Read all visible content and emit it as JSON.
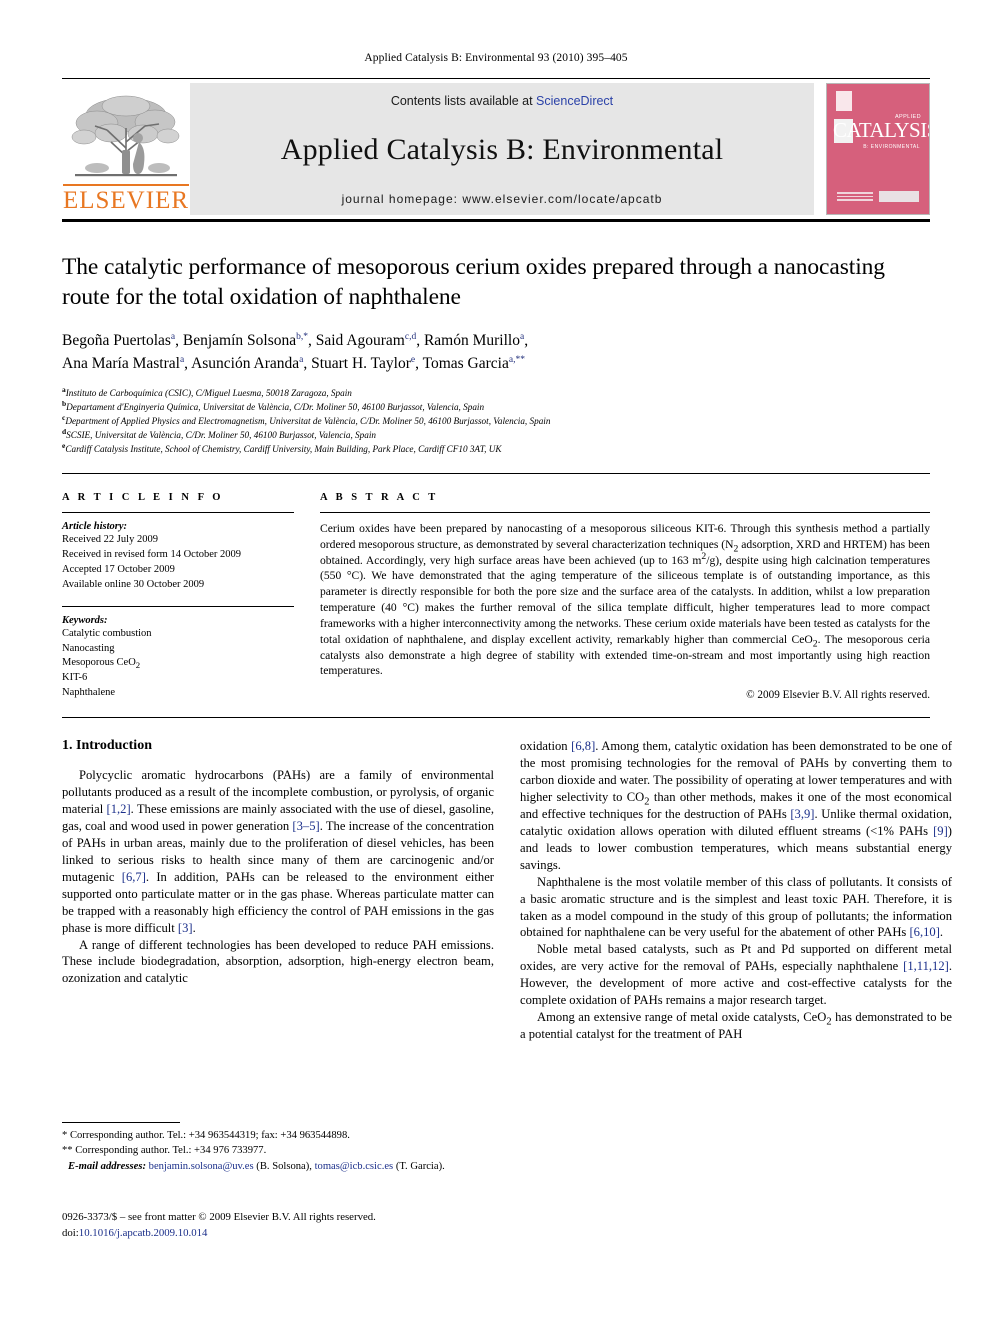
{
  "running_head": "Applied Catalysis B: Environmental 93 (2010) 395–405",
  "masthead": {
    "contents_prefix": "Contents lists available at ",
    "sciencedirect": "ScienceDirect",
    "journal_title": "Applied Catalysis B: Environmental",
    "homepage": "journal homepage: www.elsevier.com/locate/apcatb",
    "publisher_wordmark": "ELSEVIER",
    "publisher_color": "#E87722",
    "link_color": "#2b42a8",
    "cover": {
      "applied": "APPLIED",
      "catalysis": "CATALYSIS",
      "subtitle": "B: ENVIRONMENTAL",
      "background_color": "#d6607c"
    }
  },
  "article": {
    "title": "The catalytic performance of mesoporous cerium oxides prepared through a nanocasting route for the total oxidation of naphthalene",
    "authors_line1": "Begoña Puertolas ª, Benjamín Solsona b,*, Said Agouram c,d, Ramón Murillo ª,",
    "authors_line2": "Ana María Mastral ª, Asunción Aranda ª, Stuart H. Taylor e, Tomas Garcia a,**",
    "authors": [
      {
        "name": "Begoña Puertolas",
        "sup": "a"
      },
      {
        "name": "Benjamín Solsona",
        "sup": "b,*"
      },
      {
        "name": "Said Agouram",
        "sup": "c,d"
      },
      {
        "name": "Ramón Murillo",
        "sup": "a"
      },
      {
        "name": "Ana María Mastral",
        "sup": "a"
      },
      {
        "name": "Asunción Aranda",
        "sup": "a"
      },
      {
        "name": "Stuart H. Taylor",
        "sup": "e"
      },
      {
        "name": "Tomas Garcia",
        "sup": "a,**"
      }
    ],
    "affiliations": [
      {
        "mark": "a",
        "text": "Instituto de Carboquímica (CSIC), C/Miguel Luesma, 50018 Zaragoza, Spain"
      },
      {
        "mark": "b",
        "text": "Departament d'Enginyeria Química, Universitat de València, C/Dr. Moliner 50, 46100 Burjassot, Valencia, Spain"
      },
      {
        "mark": "c",
        "text": "Department of Applied Physics and Electromagnetism, Universitat de València, C/Dr. Moliner 50, 46100 Burjassot, Valencia, Spain"
      },
      {
        "mark": "d",
        "text": "SCSIE, Universitat de València, C/Dr. Moliner 50, 46100 Burjassot, Valencia, Spain"
      },
      {
        "mark": "e",
        "text": "Cardiff Catalysis Institute, School of Chemistry, Cardiff University, Main Building, Park Place, Cardiff CF10 3AT, UK"
      }
    ]
  },
  "article_info": {
    "heading": "A R T I C L E   I N F O",
    "history_label": "Article history:",
    "history": [
      "Received 22 July 2009",
      "Received in revised form 14 October 2009",
      "Accepted 17 October 2009",
      "Available online 30 October 2009"
    ],
    "keywords_label": "Keywords:",
    "keywords": [
      "Catalytic combustion",
      "Nanocasting",
      "Mesoporous CeO2",
      "KIT-6",
      "Naphthalene"
    ]
  },
  "abstract": {
    "heading": "A B S T R A C T",
    "text": "Cerium oxides have been prepared by nanocasting of a mesoporous siliceous KIT-6. Through this synthesis method a partially ordered mesoporous structure, as demonstrated by several characterization techniques (N2 adsorption, XRD and HRTEM) has been obtained. Accordingly, very high surface areas have been achieved (up to 163 m2/g), despite using high calcination temperatures (550 °C). We have demonstrated that the aging temperature of the siliceous template is of outstanding importance, as this parameter is directly responsible for both the pore size and the surface area of the catalysts. In addition, whilst a low preparation temperature (40 °C) makes the further removal of the silica template difficult, higher temperatures lead to more compact frameworks with a higher interconnectivity among the networks. These cerium oxide materials have been tested as catalysts for the total oxidation of naphthalene, and display excellent activity, remarkably higher than commercial CeO2. The mesoporous ceria catalysts also demonstrate a high degree of stability with extended time-on-stream and most importantly using high reaction temperatures.",
    "copyright": "© 2009 Elsevier B.V. All rights reserved."
  },
  "body": {
    "section_title": "1. Introduction",
    "left_paragraphs": [
      "Polycyclic aromatic hydrocarbons (PAHs) are a family of environmental pollutants produced as a result of the incomplete combustion, or pyrolysis, of organic material [1,2]. These emissions are mainly associated with the use of diesel, gasoline, gas, coal and wood used in power generation [3–5]. The increase of the concentration of PAHs in urban areas, mainly due to the proliferation of diesel vehicles, has been linked to serious risks to health since many of them are carcinogenic and/or mutagenic [6,7]. In addition, PAHs can be released to the environment either supported onto particulate matter or in the gas phase. Whereas particulate matter can be trapped with a reasonably high efficiency the control of PAH emissions in the gas phase is more difficult [3].",
      "A range of different technologies has been developed to reduce PAH emissions. These include biodegradation, absorption, adsorption, high-energy electron beam, ozonization and catalytic"
    ],
    "right_paragraphs": [
      "oxidation [6,8]. Among them, catalytic oxidation has been demonstrated to be one of the most promising technologies for the removal of PAHs by converting them to carbon dioxide and water. The possibility of operating at lower temperatures and with higher selectivity to CO2 than other methods, makes it one of the most economical and effective techniques for the destruction of PAHs [3,9]. Unlike thermal oxidation, catalytic oxidation allows operation with diluted effluent streams (<1% PAHs [9]) and leads to lower combustion temperatures, which means substantial energy savings.",
      "Naphthalene is the most volatile member of this class of pollutants. It consists of a basic aromatic structure and is the simplest and least toxic PAH. Therefore, it is taken as a model compound in the study of this group of pollutants; the information obtained for naphthalene can be very useful for the abatement of other PAHs [6,10].",
      "Noble metal based catalysts, such as Pt and Pd supported on different metal oxides, are very active for the removal of PAHs, especially naphthalene [1,11,12]. However, the development of more active and cost-effective catalysts for the complete oxidation of PAHs remains a major research target.",
      "Among an extensive range of metal oxide catalysts, CeO2 has demonstrated to be a potential catalyst for the treatment of PAH"
    ]
  },
  "footnotes": {
    "line1": "* Corresponding author. Tel.: +34 963544319; fax: +34 963544898.",
    "line2": "** Corresponding author. Tel.: +34 976 733977.",
    "email_label": "E-mail addresses:",
    "email1": "benjamin.solsona@uv.es",
    "email1_owner": "(B. Solsona),",
    "email2": "tomas@icb.csic.es",
    "email2_owner": "(T. Garcia)."
  },
  "footer": {
    "issn_line": "0926-3373/$ – see front matter © 2009 Elsevier B.V. All rights reserved.",
    "doi_label": "doi:",
    "doi": "10.1016/j.apcatb.2009.10.014"
  }
}
